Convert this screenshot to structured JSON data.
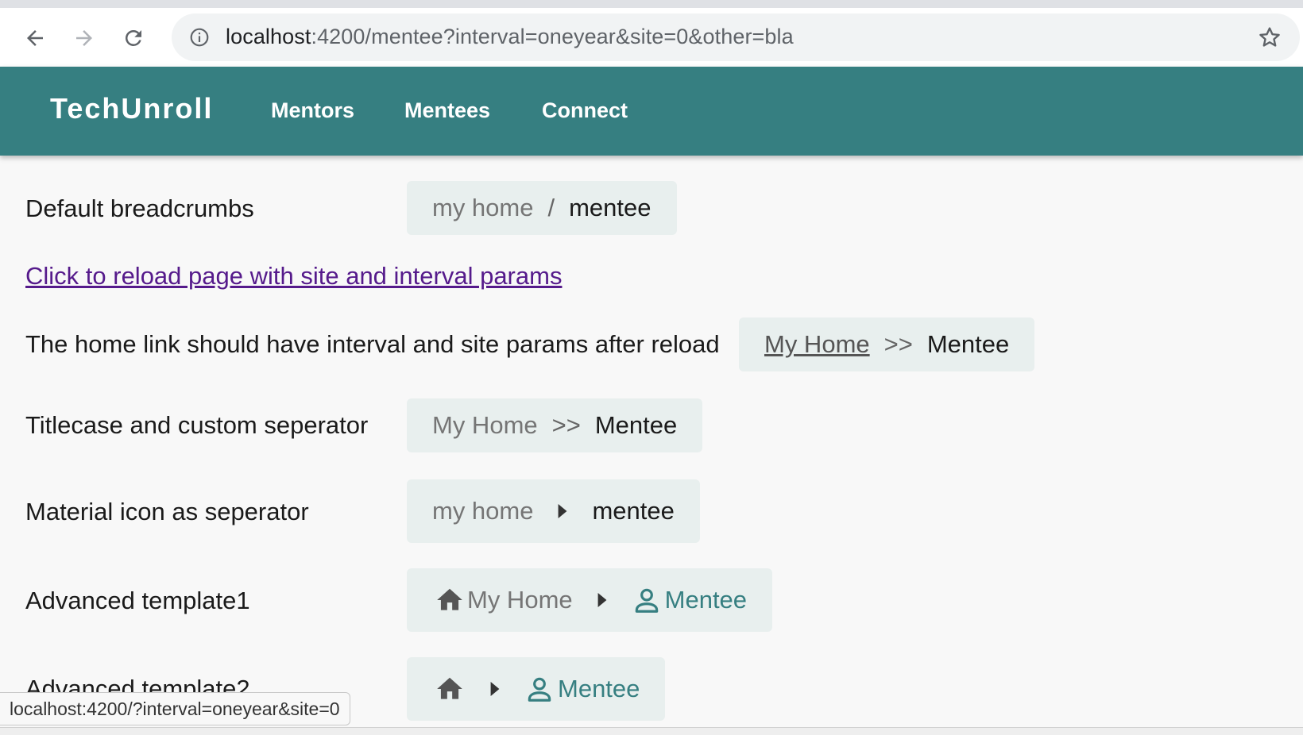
{
  "browser": {
    "url_host": "localhost",
    "url_rest": ":4200/mentee?interval=oneyear&site=0&other=bla",
    "status_url": "localhost:4200/?interval=oneyear&site=0"
  },
  "header": {
    "brand": "TechUnroll",
    "nav": [
      "Mentors",
      "Mentees",
      "Connect"
    ],
    "color": "#367f81"
  },
  "rows": {
    "default": {
      "label": "Default breadcrumbs",
      "home": "my home",
      "separator": "/",
      "current": "mentee"
    },
    "reload_link": "Click to reload page with site and interval params",
    "params": {
      "label": "The home link should have interval and site params after reload",
      "home": "My Home",
      "separator": ">>",
      "current": "Mentee"
    },
    "titlecase": {
      "label": "Titlecase and custom seperator",
      "home": "My Home",
      "separator": ">>",
      "current": "Mentee"
    },
    "material": {
      "label": "Material icon as seperator",
      "home": "my home",
      "separator_icon": "chevron-right-icon",
      "current": "mentee"
    },
    "advanced1": {
      "label": "Advanced template1",
      "home_icon": "home-icon",
      "home": "My Home",
      "separator_icon": "chevron-right-icon",
      "current_icon": "person-icon",
      "current": "Mentee"
    },
    "advanced2": {
      "label": "Advanced template2",
      "home_icon": "home-icon",
      "separator_icon": "chevron-right-icon",
      "current_icon": "person-icon",
      "current": "Mentee"
    }
  }
}
